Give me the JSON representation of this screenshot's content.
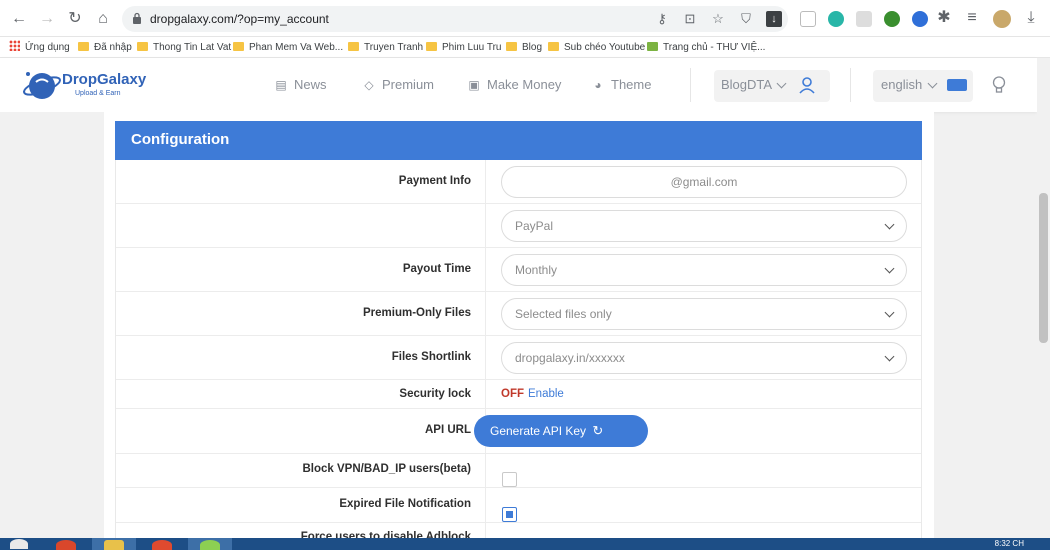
{
  "browser": {
    "url": "dropgalaxy.com/?op=my_account",
    "bookmarks": [
      "Ứng dụng",
      "Đã nhập",
      "Thong Tin Lat Vat",
      "Phan Mem Va Web...",
      "Truyen Tranh",
      "Phim Luu Tru",
      "Blog",
      "Sub chéo Youtube",
      "Trang chủ - THƯ VIỆ..."
    ]
  },
  "site": {
    "logo_title": "DropGalaxy",
    "logo_sub": "Upload & Earn",
    "nav": [
      "News",
      "Premium",
      "Make Money",
      "Theme"
    ],
    "user": "BlogDTA",
    "language": "english"
  },
  "config": {
    "title": "Configuration",
    "payment_info_label": "Payment Info",
    "payment_email": "@gmail.com",
    "payment_method": "PayPal",
    "payout_time_label": "Payout Time",
    "payout_time": "Monthly",
    "premium_only_label": "Premium-Only Files",
    "premium_only": "Selected files only",
    "shortlink_label": "Files Shortlink",
    "shortlink": "dropgalaxy.in/xxxxxx",
    "security_lock_label": "Security lock",
    "security_status": "OFF",
    "security_action": "Enable",
    "api_url_label": "API URL",
    "api_button": "Generate API Key",
    "block_vpn_label": "Block VPN/BAD_IP users(beta)",
    "block_vpn_checked": false,
    "expired_label": "Expired File Notification",
    "expired_checked": true,
    "force_adblock_label": "Force users to disable Adblock"
  },
  "system": {
    "time": "8:32 CH"
  },
  "colors": {
    "accent": "#3e7bd7",
    "off_red": "#c0392b",
    "link_blue": "#3e7bd7"
  }
}
